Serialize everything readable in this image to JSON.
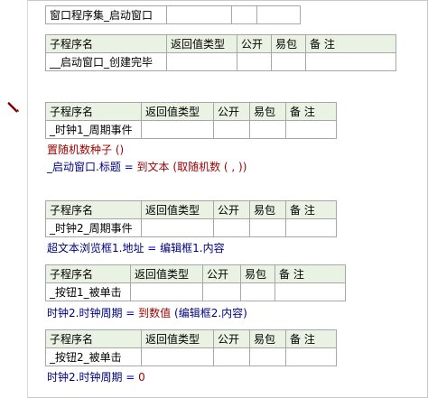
{
  "header_fn": {
    "name": "窗口程序集_启动窗口"
  },
  "columns": {
    "name": "子程序名",
    "ret": "返回值类型",
    "pub": "公开",
    "easy": "易包",
    "note": "备 注"
  },
  "subs": [
    {
      "name": "__启动窗口_创建完毕"
    },
    {
      "name": "_时钟1_周期事件"
    },
    {
      "name": "_时钟2_周期事件"
    },
    {
      "name": "_按钮1_被单击"
    },
    {
      "name": "_按钮2_被单击"
    }
  ],
  "code": {
    "l1": "置随机数种子 ()",
    "l2_a": "_启动窗口.标题",
    "l2_op": "=",
    "l2_fn": "到文本",
    "l2_b": "(取随机数 ( , ))",
    "l3_a": "超文本浏览框1.地址",
    "l3_op": "=",
    "l3_b": "编辑框1.内容",
    "l4_a": "时钟2.时钟周期",
    "l4_op": "=",
    "l4_fn": "到数值",
    "l4_b": "(编辑框2.内容)",
    "l5_a": "时钟2.时钟周期",
    "l5_op": "=",
    "l5_val": "0"
  },
  "icons": {
    "breakpoint": "pencil-breakpoint-icon"
  },
  "colors": {
    "header_bg": "#eaf2e3",
    "keyword": "#000080",
    "func": "#9b0000",
    "operator": "#0000ff",
    "border": "#a7a7a7"
  }
}
